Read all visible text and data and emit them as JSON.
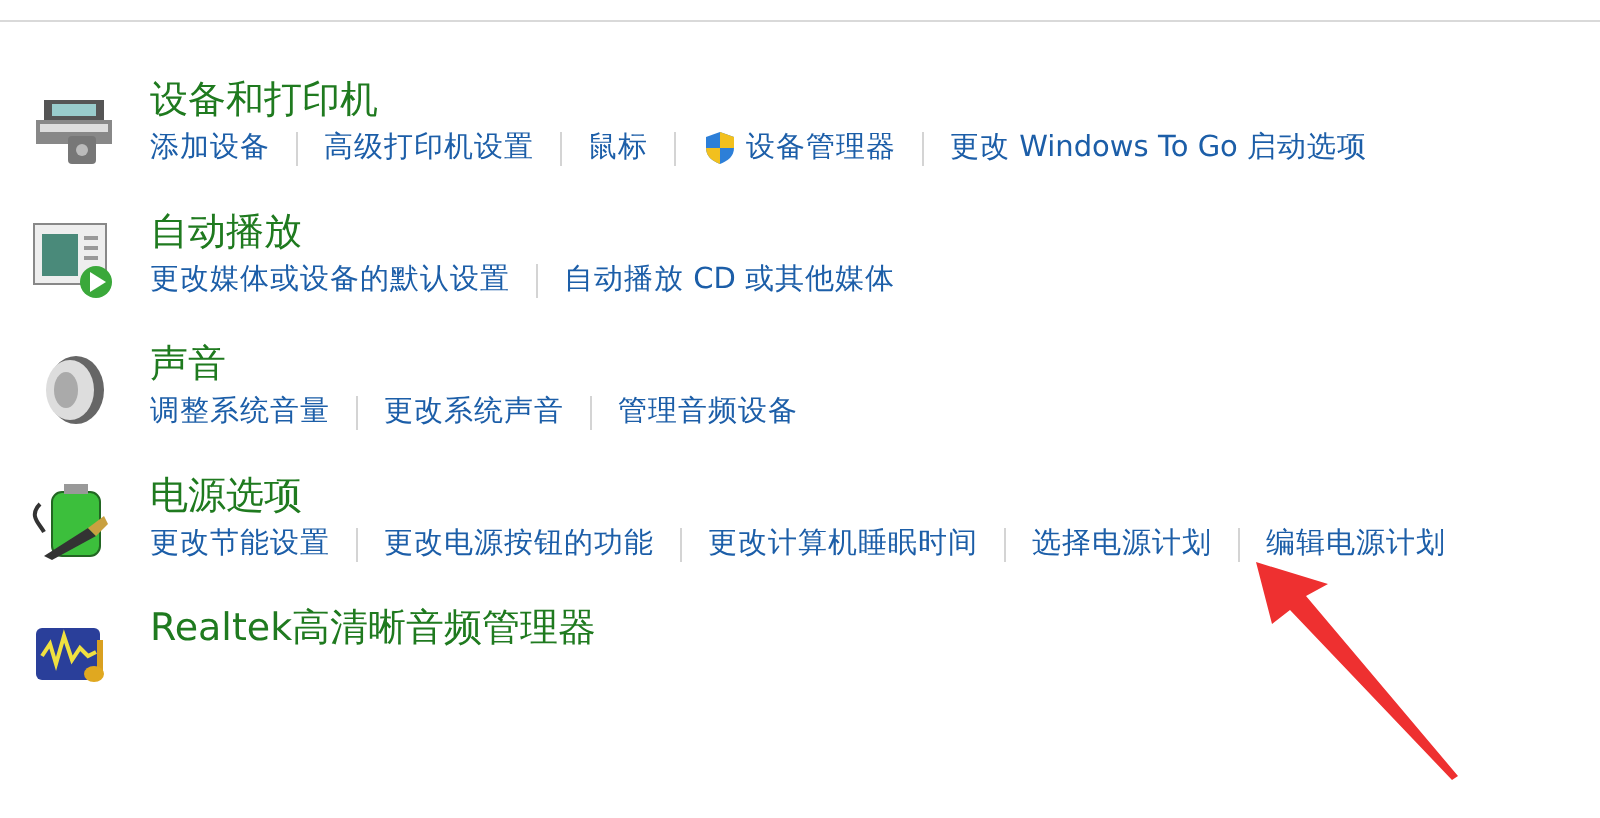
{
  "sections": [
    {
      "kind": "printer",
      "title": "设备和打印机",
      "links": [
        {
          "text": "添加设备",
          "kind": "plain"
        },
        {
          "text": "高级打印机设置",
          "kind": "plain"
        },
        {
          "text": "鼠标",
          "kind": "plain"
        },
        {
          "text": "设备管理器",
          "kind": "shield"
        },
        {
          "text": "更改 Windows To Go 启动选项",
          "kind": "plain"
        }
      ]
    },
    {
      "kind": "autoplay",
      "title": "自动播放",
      "links": [
        {
          "text": "更改媒体或设备的默认设置",
          "kind": "plain"
        },
        {
          "text": "自动播放 CD 或其他媒体",
          "kind": "plain"
        }
      ]
    },
    {
      "kind": "speaker",
      "title": "声音",
      "links": [
        {
          "text": "调整系统音量",
          "kind": "plain"
        },
        {
          "text": "更改系统声音",
          "kind": "plain"
        },
        {
          "text": "管理音频设备",
          "kind": "plain"
        }
      ]
    },
    {
      "kind": "battery",
      "title": "电源选项",
      "links": [
        {
          "text": "更改节能设置",
          "kind": "plain"
        },
        {
          "text": "更改电源按钮的功能",
          "kind": "plain"
        },
        {
          "text": "更改计算机睡眠时间",
          "kind": "plain"
        },
        {
          "text": "选择电源计划",
          "kind": "plain"
        },
        {
          "text": "编辑电源计划",
          "kind": "plain"
        }
      ]
    },
    {
      "kind": "realtek",
      "title": "Realtek高清晰音频管理器"
    }
  ]
}
